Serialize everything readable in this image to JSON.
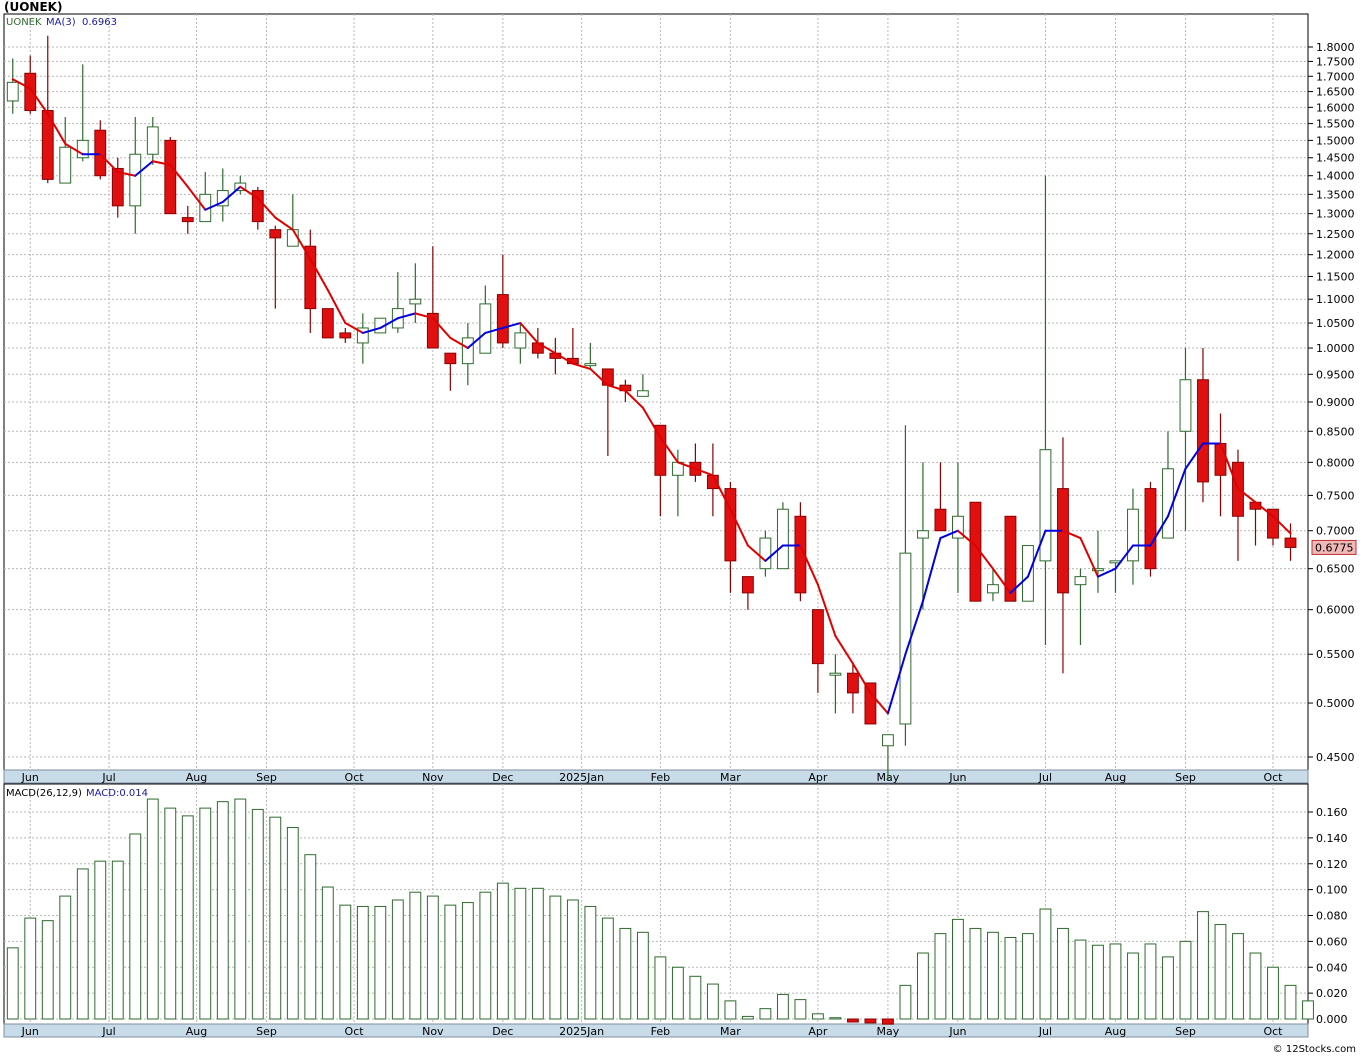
{
  "title": "(UONEK)",
  "copyright": "© 12Stocks.com",
  "chart_data": [
    {
      "type": "candlestick",
      "panel": "price",
      "legend": {
        "symbol": "UONEK",
        "ma_label": "MA(3)",
        "ma_value": "0.6963"
      },
      "last_price_label": "0.6775",
      "y_ticks": [
        "1.8000",
        "1.7500",
        "1.7000",
        "1.6500",
        "1.6000",
        "1.5500",
        "1.5000",
        "1.4500",
        "1.4000",
        "1.3500",
        "1.3000",
        "1.2500",
        "1.2000",
        "1.1500",
        "1.1000",
        "1.0500",
        "1.0000",
        "0.9500",
        "0.9000",
        "0.8500",
        "0.8000",
        "0.7500",
        "0.7000",
        "0.6500",
        "0.6000",
        "0.5500",
        "0.5000",
        "0.4500"
      ],
      "log_scale": true,
      "x_labels": [
        {
          "label": "Jun",
          "week": 1
        },
        {
          "label": "Jul",
          "week": 5.5
        },
        {
          "label": "Aug",
          "week": 10.5
        },
        {
          "label": "Sep",
          "week": 14.5
        },
        {
          "label": "Oct",
          "week": 19.5
        },
        {
          "label": "Nov",
          "week": 24
        },
        {
          "label": "Dec",
          "week": 28
        },
        {
          "label": "2025Jan",
          "week": 32.5
        },
        {
          "label": "Feb",
          "week": 37
        },
        {
          "label": "Mar",
          "week": 41
        },
        {
          "label": "Apr",
          "week": 46
        },
        {
          "label": "May",
          "week": 50
        },
        {
          "label": "Jun",
          "week": 54
        },
        {
          "label": "Jul",
          "week": 59
        },
        {
          "label": "Aug",
          "week": 63
        },
        {
          "label": "Sep",
          "week": 67
        },
        {
          "label": "Oct",
          "week": 72
        }
      ],
      "candles": [
        {
          "o": 1.62,
          "h": 1.76,
          "l": 1.58,
          "c": 1.68
        },
        {
          "o": 1.71,
          "h": 1.77,
          "l": 1.58,
          "c": 1.59
        },
        {
          "o": 1.59,
          "h": 1.84,
          "l": 1.38,
          "c": 1.39
        },
        {
          "o": 1.38,
          "h": 1.57,
          "l": 1.38,
          "c": 1.48
        },
        {
          "o": 1.45,
          "h": 1.74,
          "l": 1.44,
          "c": 1.5
        },
        {
          "o": 1.53,
          "h": 1.56,
          "l": 1.39,
          "c": 1.4
        },
        {
          "o": 1.42,
          "h": 1.45,
          "l": 1.29,
          "c": 1.32
        },
        {
          "o": 1.32,
          "h": 1.57,
          "l": 1.25,
          "c": 1.46
        },
        {
          "o": 1.46,
          "h": 1.57,
          "l": 1.43,
          "c": 1.54
        },
        {
          "o": 1.5,
          "h": 1.51,
          "l": 1.3,
          "c": 1.3
        },
        {
          "o": 1.29,
          "h": 1.32,
          "l": 1.25,
          "c": 1.28
        },
        {
          "o": 1.28,
          "h": 1.41,
          "l": 1.28,
          "c": 1.35
        },
        {
          "o": 1.32,
          "h": 1.42,
          "l": 1.28,
          "c": 1.36
        },
        {
          "o": 1.36,
          "h": 1.4,
          "l": 1.35,
          "c": 1.38
        },
        {
          "o": 1.36,
          "h": 1.37,
          "l": 1.26,
          "c": 1.28
        },
        {
          "o": 1.26,
          "h": 1.27,
          "l": 1.08,
          "c": 1.24
        },
        {
          "o": 1.22,
          "h": 1.35,
          "l": 1.22,
          "c": 1.26
        },
        {
          "o": 1.22,
          "h": 1.26,
          "l": 1.03,
          "c": 1.08
        },
        {
          "o": 1.08,
          "h": 1.08,
          "l": 1.02,
          "c": 1.02
        },
        {
          "o": 1.03,
          "h": 1.04,
          "l": 1.01,
          "c": 1.02
        },
        {
          "o": 1.01,
          "h": 1.07,
          "l": 0.97,
          "c": 1.04
        },
        {
          "o": 1.03,
          "h": 1.06,
          "l": 1.03,
          "c": 1.06
        },
        {
          "o": 1.04,
          "h": 1.16,
          "l": 1.03,
          "c": 1.08
        },
        {
          "o": 1.09,
          "h": 1.18,
          "l": 1.05,
          "c": 1.1
        },
        {
          "o": 1.07,
          "h": 1.22,
          "l": 1.0,
          "c": 1.0
        },
        {
          "o": 0.99,
          "h": 0.99,
          "l": 0.92,
          "c": 0.97
        },
        {
          "o": 0.97,
          "h": 1.05,
          "l": 0.93,
          "c": 1.02
        },
        {
          "o": 0.99,
          "h": 1.13,
          "l": 0.99,
          "c": 1.09
        },
        {
          "o": 1.11,
          "h": 1.2,
          "l": 1.0,
          "c": 1.01
        },
        {
          "o": 1.0,
          "h": 1.05,
          "l": 0.97,
          "c": 1.03
        },
        {
          "o": 1.01,
          "h": 1.04,
          "l": 0.98,
          "c": 0.99
        },
        {
          "o": 0.99,
          "h": 1.02,
          "l": 0.95,
          "c": 0.98
        },
        {
          "o": 0.98,
          "h": 1.04,
          "l": 0.98,
          "c": 0.97
        },
        {
          "o": 0.97,
          "h": 1.01,
          "l": 0.96,
          "c": 0.97
        },
        {
          "o": 0.96,
          "h": 0.96,
          "l": 0.81,
          "c": 0.93
        },
        {
          "o": 0.93,
          "h": 0.94,
          "l": 0.9,
          "c": 0.92
        },
        {
          "o": 0.91,
          "h": 0.95,
          "l": 0.91,
          "c": 0.92
        },
        {
          "o": 0.86,
          "h": 0.86,
          "l": 0.72,
          "c": 0.78
        },
        {
          "o": 0.78,
          "h": 0.82,
          "l": 0.72,
          "c": 0.8
        },
        {
          "o": 0.8,
          "h": 0.83,
          "l": 0.77,
          "c": 0.78
        },
        {
          "o": 0.78,
          "h": 0.83,
          "l": 0.72,
          "c": 0.76
        },
        {
          "o": 0.76,
          "h": 0.77,
          "l": 0.62,
          "c": 0.66
        },
        {
          "o": 0.64,
          "h": 0.64,
          "l": 0.6,
          "c": 0.62
        },
        {
          "o": 0.65,
          "h": 0.7,
          "l": 0.64,
          "c": 0.69
        },
        {
          "o": 0.65,
          "h": 0.74,
          "l": 0.65,
          "c": 0.73
        },
        {
          "o": 0.72,
          "h": 0.74,
          "l": 0.61,
          "c": 0.62
        },
        {
          "o": 0.6,
          "h": 0.6,
          "l": 0.51,
          "c": 0.54
        },
        {
          "o": 0.53,
          "h": 0.55,
          "l": 0.49,
          "c": 0.53
        },
        {
          "o": 0.53,
          "h": 0.54,
          "l": 0.49,
          "c": 0.51
        },
        {
          "o": 0.52,
          "h": 0.52,
          "l": 0.48,
          "c": 0.48
        },
        {
          "o": 0.46,
          "h": 0.47,
          "l": 0.43,
          "c": 0.47
        },
        {
          "o": 0.48,
          "h": 0.86,
          "l": 0.46,
          "c": 0.67
        },
        {
          "o": 0.69,
          "h": 0.8,
          "l": 0.6,
          "c": 0.7
        },
        {
          "o": 0.73,
          "h": 0.8,
          "l": 0.7,
          "c": 0.7
        },
        {
          "o": 0.69,
          "h": 0.8,
          "l": 0.62,
          "c": 0.72
        },
        {
          "o": 0.74,
          "h": 0.74,
          "l": 0.61,
          "c": 0.61
        },
        {
          "o": 0.62,
          "h": 0.65,
          "l": 0.61,
          "c": 0.63
        },
        {
          "o": 0.72,
          "h": 0.72,
          "l": 0.61,
          "c": 0.61
        },
        {
          "o": 0.61,
          "h": 0.68,
          "l": 0.61,
          "c": 0.68
        },
        {
          "o": 0.66,
          "h": 1.4,
          "l": 0.56,
          "c": 0.82
        },
        {
          "o": 0.76,
          "h": 0.84,
          "l": 0.53,
          "c": 0.62
        },
        {
          "o": 0.63,
          "h": 0.65,
          "l": 0.56,
          "c": 0.64
        },
        {
          "o": 0.65,
          "h": 0.7,
          "l": 0.62,
          "c": 0.65
        },
        {
          "o": 0.66,
          "h": 0.66,
          "l": 0.62,
          "c": 0.66
        },
        {
          "o": 0.66,
          "h": 0.76,
          "l": 0.63,
          "c": 0.73
        },
        {
          "o": 0.76,
          "h": 0.77,
          "l": 0.64,
          "c": 0.65
        },
        {
          "o": 0.69,
          "h": 0.85,
          "l": 0.69,
          "c": 0.79
        },
        {
          "o": 0.85,
          "h": 1.0,
          "l": 0.7,
          "c": 0.94
        },
        {
          "o": 0.94,
          "h": 1.0,
          "l": 0.74,
          "c": 0.77
        },
        {
          "o": 0.83,
          "h": 0.88,
          "l": 0.72,
          "c": 0.78
        },
        {
          "o": 0.8,
          "h": 0.82,
          "l": 0.66,
          "c": 0.72
        },
        {
          "o": 0.74,
          "h": 0.74,
          "l": 0.68,
          "c": 0.73
        },
        {
          "o": 0.73,
          "h": 0.73,
          "l": 0.68,
          "c": 0.69
        },
        {
          "o": 0.69,
          "h": 0.71,
          "l": 0.66,
          "c": 0.6775
        }
      ],
      "ma3": [
        1.69,
        1.66,
        1.58,
        1.49,
        1.46,
        1.46,
        1.41,
        1.4,
        1.44,
        1.43,
        1.37,
        1.31,
        1.33,
        1.37,
        1.34,
        1.29,
        1.26,
        1.19,
        1.12,
        1.05,
        1.03,
        1.04,
        1.06,
        1.07,
        1.06,
        1.02,
        1.0,
        1.03,
        1.04,
        1.05,
        1.01,
        0.99,
        0.97,
        0.96,
        0.93,
        0.92,
        0.89,
        0.84,
        0.8,
        0.79,
        0.78,
        0.73,
        0.68,
        0.66,
        0.68,
        0.68,
        0.63,
        0.57,
        0.54,
        0.51,
        0.49,
        0.55,
        0.61,
        0.69,
        0.7,
        0.68,
        0.65,
        0.62,
        0.64,
        0.7,
        0.7,
        0.69,
        0.64,
        0.65,
        0.68,
        0.68,
        0.72,
        0.79,
        0.83,
        0.83,
        0.76,
        0.74,
        0.72,
        0.6963
      ]
    },
    {
      "type": "bar",
      "panel": "macd",
      "legend": {
        "label": "MACD(26,12,9)",
        "value_label": "MACD:0.014"
      },
      "y_ticks": [
        "0.160",
        "0.140",
        "0.120",
        "0.100",
        "0.080",
        "0.060",
        "0.040",
        "0.020",
        "0.000"
      ],
      "ylim": [
        0,
        0.17
      ],
      "values": [
        0.055,
        0.078,
        0.076,
        0.095,
        0.116,
        0.122,
        0.122,
        0.143,
        0.17,
        0.163,
        0.157,
        0.163,
        0.168,
        0.17,
        0.162,
        0.156,
        0.148,
        0.127,
        0.102,
        0.088,
        0.087,
        0.087,
        0.092,
        0.098,
        0.095,
        0.088,
        0.09,
        0.098,
        0.105,
        0.101,
        0.101,
        0.095,
        0.092,
        0.087,
        0.078,
        0.07,
        0.067,
        0.048,
        0.04,
        0.033,
        0.027,
        0.014,
        0.002,
        0.008,
        0.019,
        0.015,
        0.004,
        0.001,
        -0.002,
        -0.003,
        -0.004,
        0.026,
        0.051,
        0.066,
        0.077,
        0.07,
        0.067,
        0.063,
        0.066,
        0.085,
        0.07,
        0.061,
        0.057,
        0.058,
        0.051,
        0.058,
        0.048,
        0.06,
        0.083,
        0.073,
        0.066,
        0.051,
        0.04,
        0.026,
        0.014
      ]
    }
  ]
}
